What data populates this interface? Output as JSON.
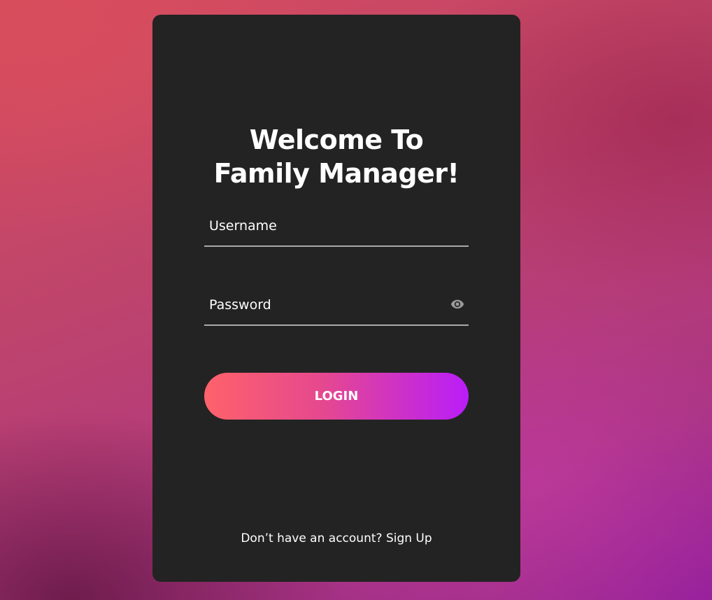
{
  "login_card": {
    "title_line1": "Welcome To",
    "title_line2": "Family Manager!",
    "username": {
      "value": "",
      "placeholder": "Username"
    },
    "password": {
      "value": "",
      "placeholder": "Password",
      "toggle_icon": "eye-icon"
    },
    "login_label": "LOGIN",
    "footer_prompt": "Don’t have an account?",
    "signup_label": "Sign Up"
  },
  "colors": {
    "card_background": "#232323",
    "button_gradient_start": "#fe626a",
    "button_gradient_end": "#b91df9",
    "underline": "#a9a9a9"
  }
}
